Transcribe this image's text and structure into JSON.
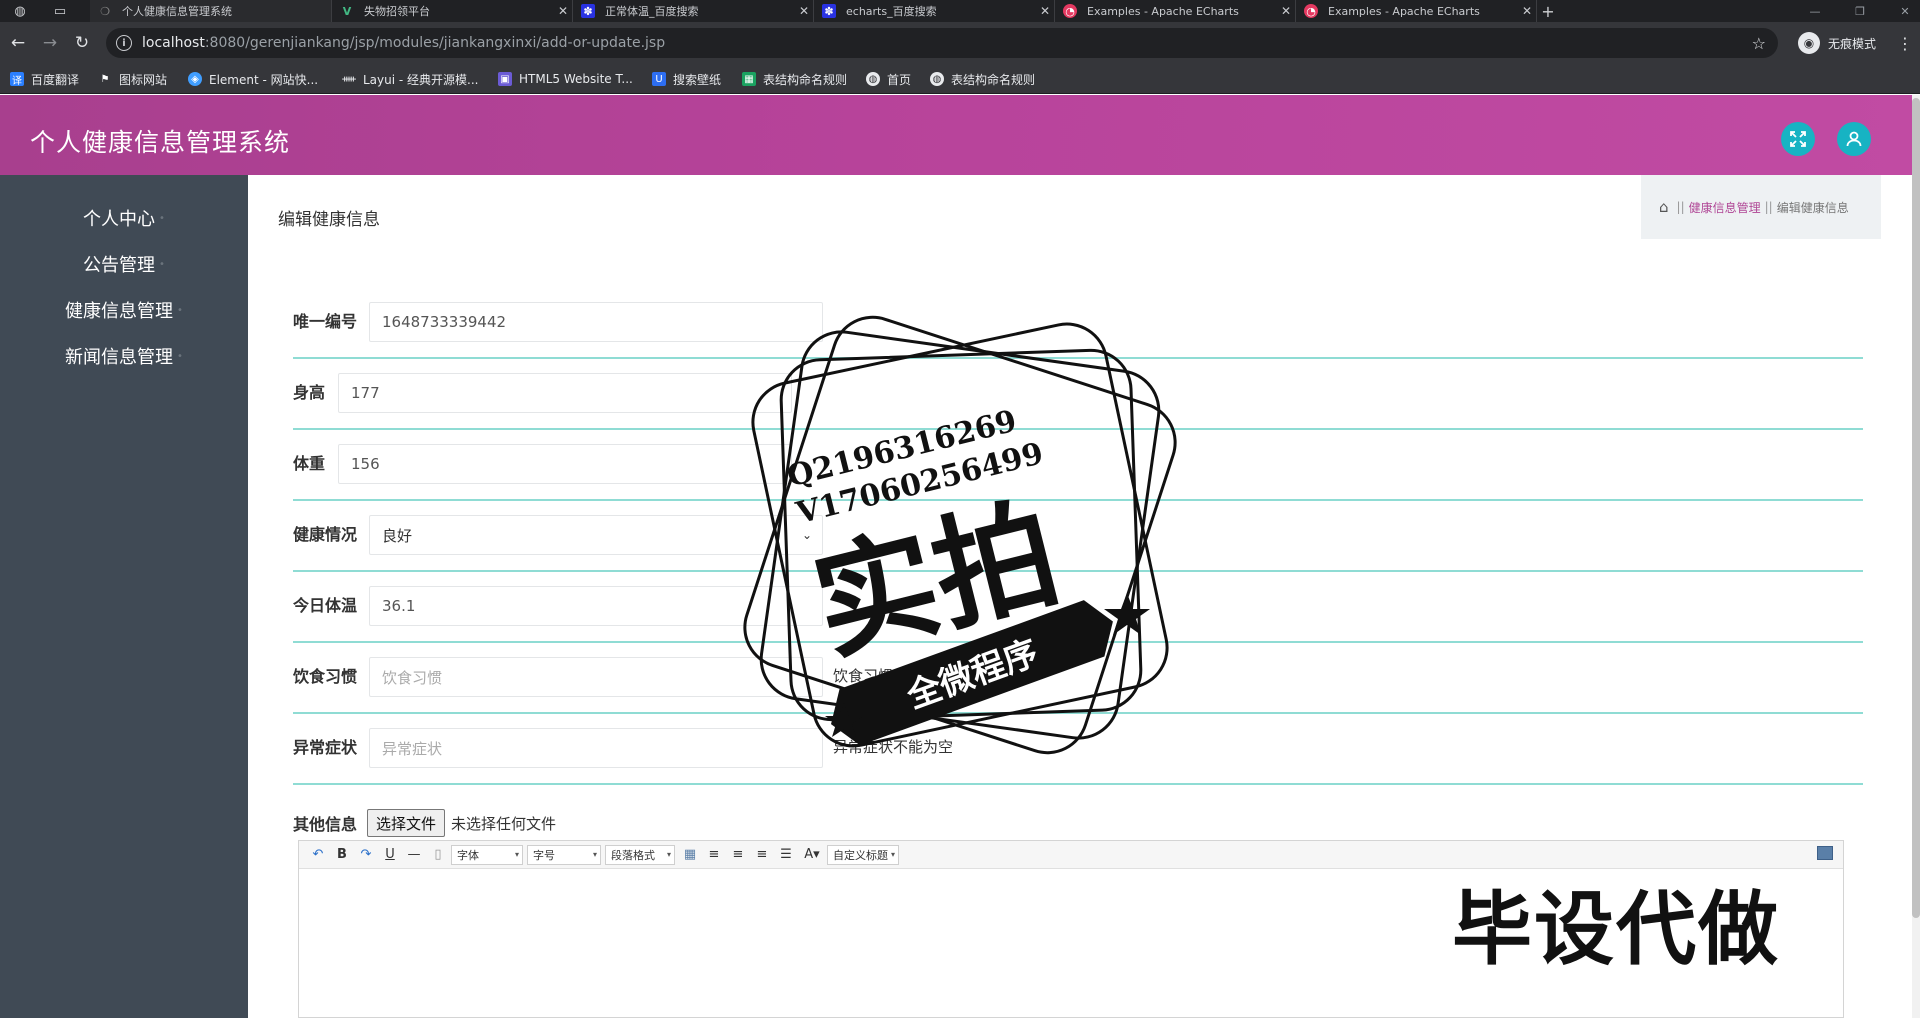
{
  "browser": {
    "tabs": [
      {
        "label": "个人健康信息管理系统",
        "icon": "page-icon"
      },
      {
        "label": "失物招领平台",
        "icon": "vue-icon"
      },
      {
        "label": "正常体温_百度搜索",
        "icon": "baidu-icon"
      },
      {
        "label": "echarts_百度搜索",
        "icon": "baidu-icon"
      },
      {
        "label": "Examples - Apache ECharts",
        "icon": "echarts-icon"
      },
      {
        "label": "Examples - Apache ECharts",
        "icon": "echarts-icon"
      }
    ],
    "url_host": "localhost",
    "url_path": ":8080/gerenjiankang/jsp/modules/jiankangxinxi/add-or-update.jsp",
    "profile_label": "无痕模式",
    "bookmarks": [
      {
        "label": "百度翻译"
      },
      {
        "label": "图标网站"
      },
      {
        "label": "Element - 网站快..."
      },
      {
        "label": "Layui - 经典开源模..."
      },
      {
        "label": "HTML5 Website T..."
      },
      {
        "label": "搜索壁纸"
      },
      {
        "label": "表结构命名规则"
      },
      {
        "label": "首页"
      },
      {
        "label": "表结构命名规则"
      }
    ]
  },
  "app": {
    "title": "个人健康信息管理系统",
    "sidebar": [
      {
        "label": "个人中心"
      },
      {
        "label": "公告管理"
      },
      {
        "label": "健康信息管理"
      },
      {
        "label": "新闻信息管理"
      }
    ],
    "page_title": "编辑健康信息",
    "breadcrumb": {
      "parent": "健康信息管理",
      "current": "编辑健康信息",
      "sep": "||"
    }
  },
  "form": {
    "id": {
      "label": "唯一编号",
      "value": "1648733339442"
    },
    "height": {
      "label": "身高",
      "value": "177"
    },
    "weight": {
      "label": "体重",
      "value": "156"
    },
    "health": {
      "label": "健康情况",
      "value": "良好"
    },
    "temperature": {
      "label": "今日体温",
      "value": "36.1"
    },
    "diet": {
      "label": "饮食习惯",
      "placeholder": "饮食习惯",
      "hint": "饮食习惯不能为空"
    },
    "symptom": {
      "label": "异常症状",
      "placeholder": "异常症状",
      "hint": "异常症状不能为空"
    },
    "other": {
      "label": "其他信息",
      "file_button": "选择文件",
      "file_status": "未选择任何文件"
    }
  },
  "editor": {
    "font_label": "字体",
    "size_label": "字号",
    "para_label": "段落格式",
    "custom_label": "自定义标题"
  },
  "watermark": {
    "qq": "Q2196316269",
    "vx": "V17060256499",
    "big": "实拍",
    "banner": "全微程序",
    "corner": "毕设代做"
  }
}
